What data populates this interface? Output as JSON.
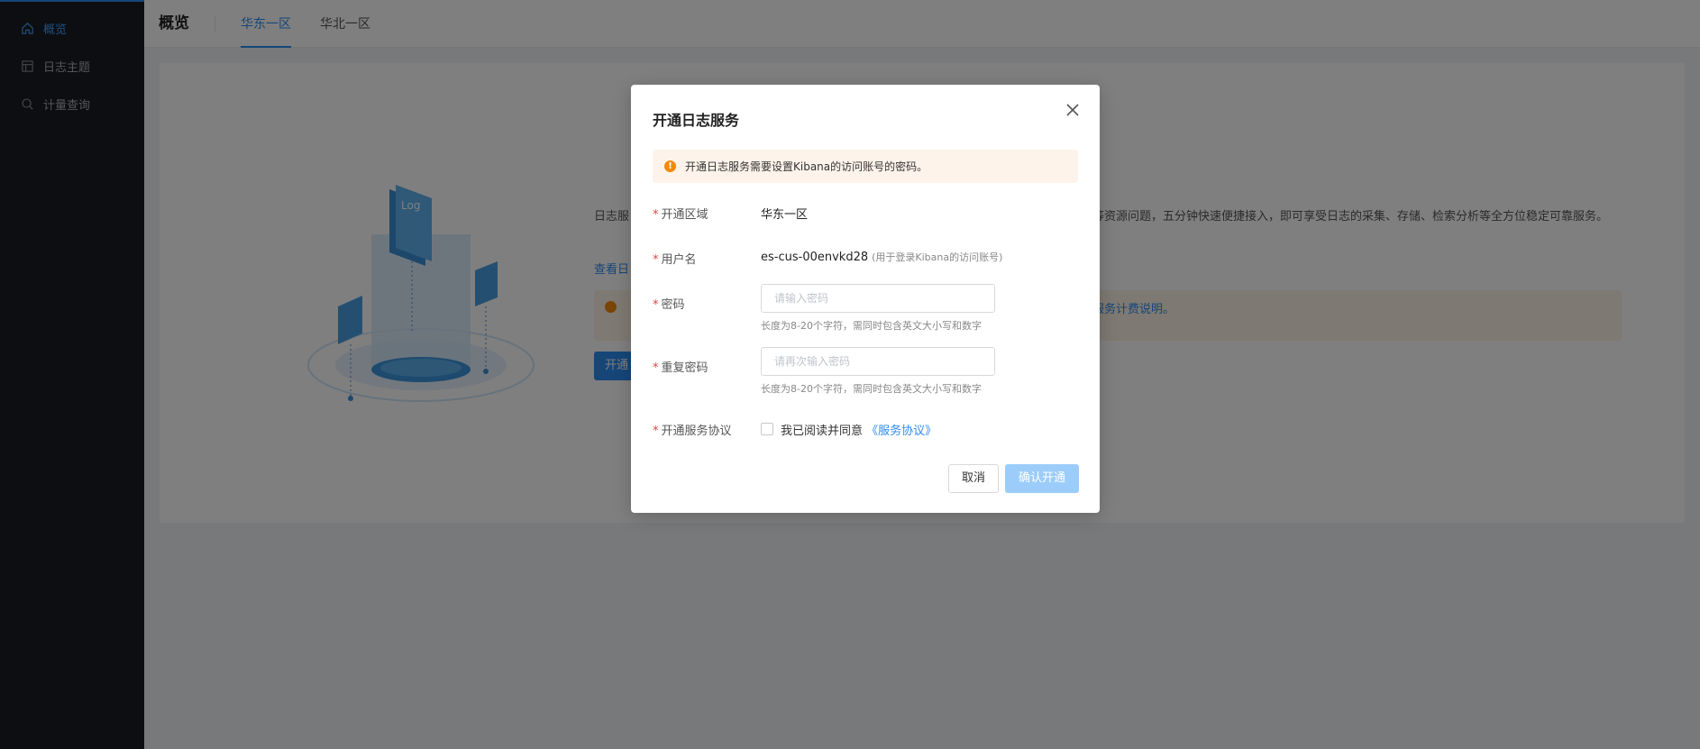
{
  "colors": {
    "accent": "#2d8cf0",
    "sidebar_bg": "#1b1d23",
    "required": "#e8423c",
    "warning": "#f5890a",
    "disabled_button": "#9ccdfa"
  },
  "sidebar": {
    "items": [
      {
        "label": "概览",
        "icon": "home-icon",
        "active": true
      },
      {
        "label": "日志主题",
        "icon": "table-icon",
        "active": false
      },
      {
        "label": "计量查询",
        "icon": "search-icon",
        "active": false
      }
    ]
  },
  "header": {
    "title": "概览",
    "tabs": [
      {
        "label": "华东一区",
        "active": true
      },
      {
        "label": "华北一区",
        "active": false
      }
    ]
  },
  "background": {
    "intro_text": "日志服",
    "intro_text_right": "等资源问题，五分钟快速便捷接入，即可享受日志的采集、存储、检索分析等全方位稳定可靠服务。",
    "link_text": "查看日",
    "notice_link": "志服务计费说明。",
    "button_label": "开通"
  },
  "modal": {
    "title": "开通日志服务",
    "alert": "开通日志服务需要设置Kibana的访问账号的密码。",
    "region": {
      "label": "开通区域",
      "value": "华东一区"
    },
    "username": {
      "label": "用户名",
      "value": "es-cus-00envkd28",
      "hint": "(用于登录Kibana的访问账号)"
    },
    "password": {
      "label": "密码",
      "placeholder": "请输入密码",
      "hint": "长度为8-20个字符，需同时包含英文大小写和数字"
    },
    "confirm_password": {
      "label": "重复密码",
      "placeholder": "请再次输入密码",
      "hint": "长度为8-20个字符，需同时包含英文大小写和数字"
    },
    "agreement": {
      "label": "开通服务协议",
      "text": "我已阅读并同意",
      "link": "《服务协议》"
    },
    "cancel": "取消",
    "confirm": "确认开通"
  }
}
